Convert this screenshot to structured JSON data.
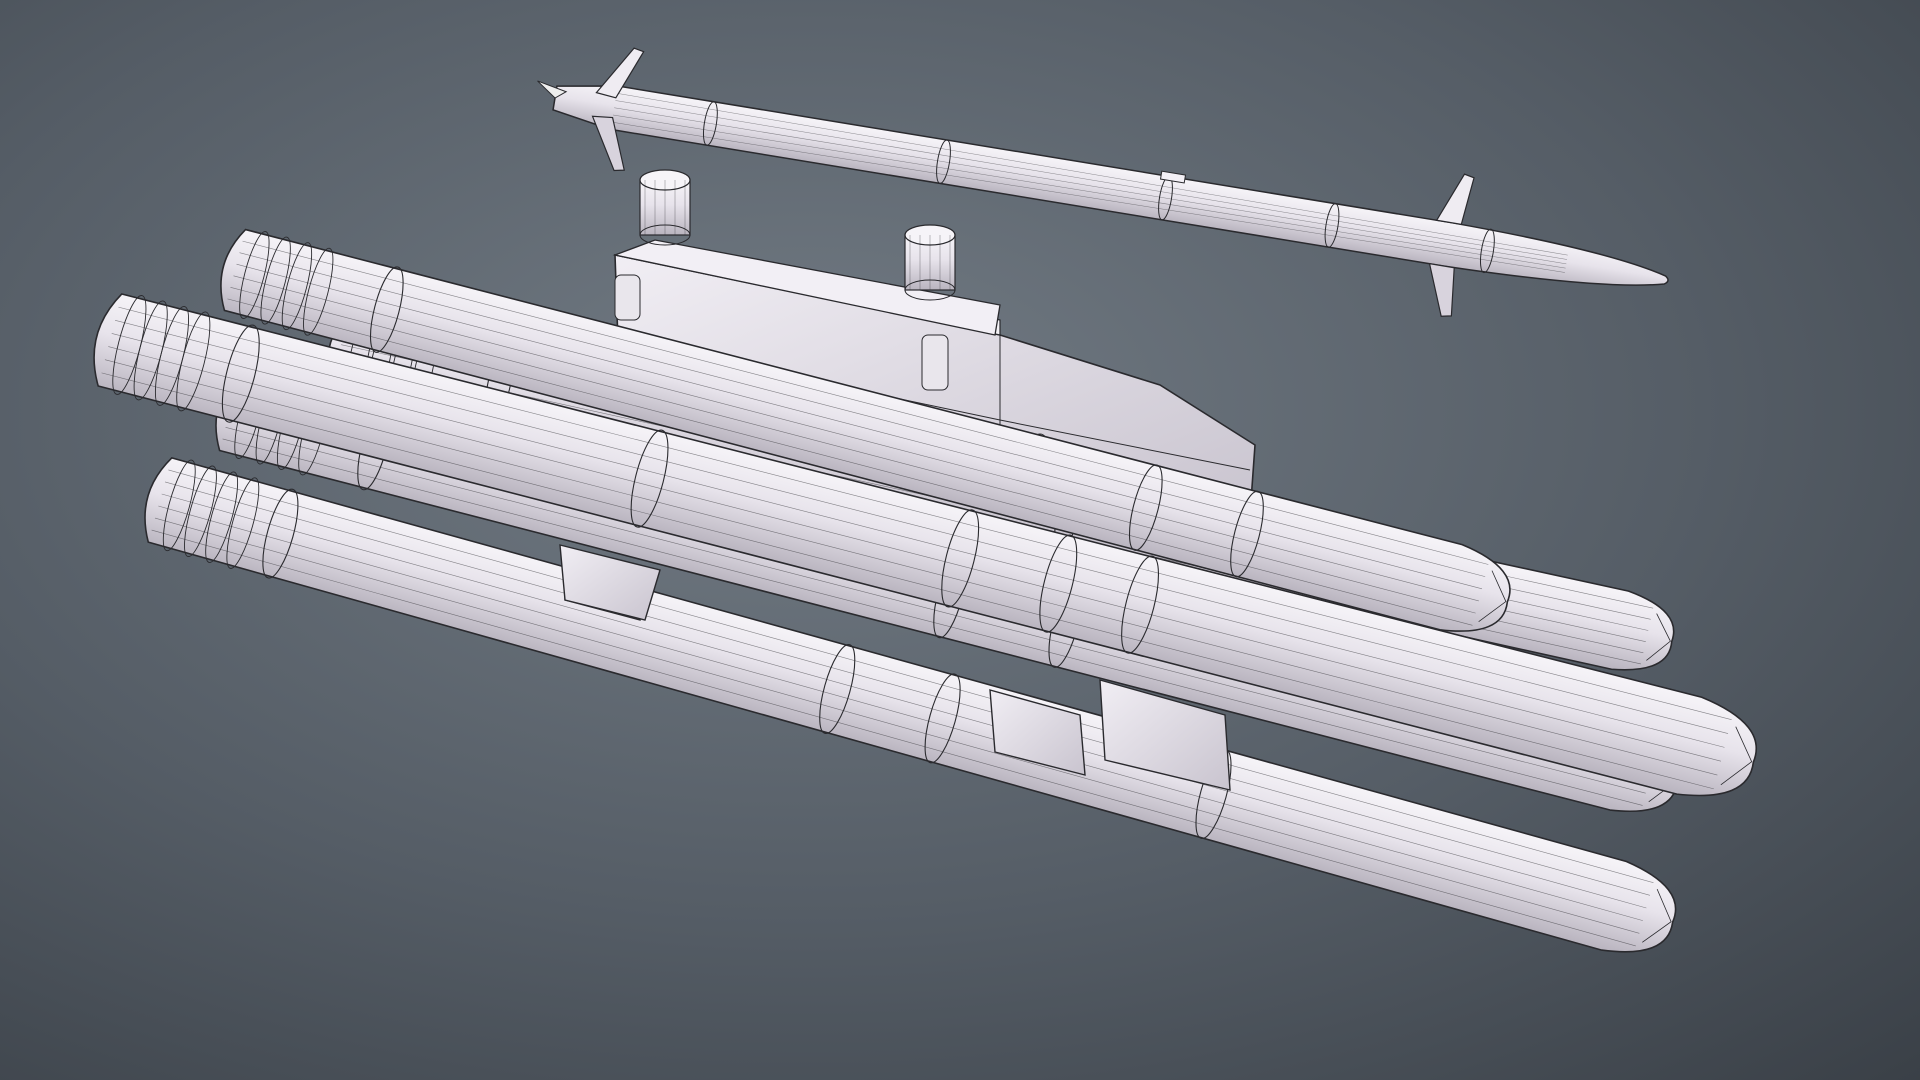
{
  "scene": {
    "subject": "wireframe-missile-launcher",
    "render_style": "shaded-wireframe",
    "colors": {
      "background_center": "#727b84",
      "background_edge": "#3a4047",
      "model_fill": "#eae6ee",
      "model_shade": "#b9b4bf",
      "model_highlight": "#f6f4f8",
      "wire": "#2a2a2e"
    }
  }
}
